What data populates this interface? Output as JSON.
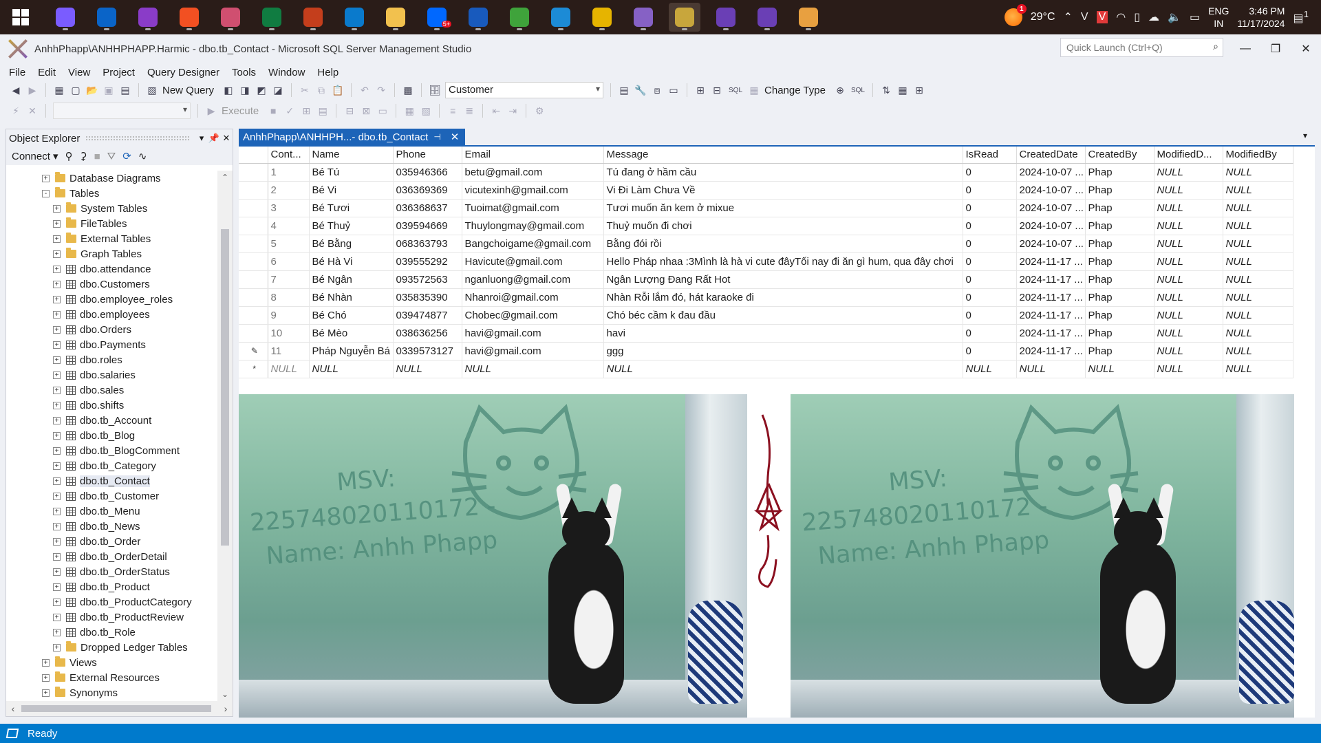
{
  "taskbar": {
    "apps": [
      {
        "name": "copilot-icon",
        "color": "#7a5cff",
        "active": false
      },
      {
        "name": "outlook-icon",
        "color": "#0a64c8",
        "active": false
      },
      {
        "name": "dev-app-icon",
        "color": "#8a3cc8",
        "active": false
      },
      {
        "name": "microsoft-store-icon",
        "color": "#f25022",
        "active": false
      },
      {
        "name": "slides-icon",
        "color": "#d04f70",
        "active": false
      },
      {
        "name": "excel-icon",
        "color": "#107c41",
        "active": false
      },
      {
        "name": "powerpoint-icon",
        "color": "#c43e1c",
        "active": false
      },
      {
        "name": "vscode-icon",
        "color": "#0a7acc",
        "active": false
      },
      {
        "name": "file-explorer-icon",
        "color": "#f2c14e",
        "active": false
      },
      {
        "name": "zalo-icon",
        "color": "#0068ff",
        "badge": "5+",
        "active": false
      },
      {
        "name": "word-icon",
        "color": "#185abd",
        "active": false
      },
      {
        "name": "cococ-browser-icon",
        "color": "#3fa33b",
        "active": false
      },
      {
        "name": "edge-icon",
        "color": "#1c8bd6",
        "active": false
      },
      {
        "name": "chrome-icon",
        "color": "#e6b400",
        "active": false
      },
      {
        "name": "visual-studio-icon",
        "color": "#8661c5",
        "active": false
      },
      {
        "name": "ssms-icon",
        "color": "#c8a63c",
        "active": true
      },
      {
        "name": "visual-studio-preview-icon",
        "color": "#6a3fb5",
        "active": false
      },
      {
        "name": "visual-studio-preview-2-icon",
        "color": "#6a3fb5",
        "active": false
      },
      {
        "name": "paint-icon",
        "color": "#e8a040",
        "active": false
      }
    ],
    "weather_badge": "1",
    "temperature": "29°C",
    "lang_top": "ENG",
    "lang_bottom": "IN",
    "time": "3:46 PM",
    "date": "11/17/2024",
    "notification_count": "1"
  },
  "window": {
    "title": "AnhhPhapp\\ANHHPHAPP.Harmic - dbo.tb_Contact - Microsoft SQL Server Management Studio",
    "quick_launch_placeholder": "Quick Launch (Ctrl+Q)"
  },
  "menu": [
    "File",
    "Edit",
    "View",
    "Project",
    "Query Designer",
    "Tools",
    "Window",
    "Help"
  ],
  "toolbar": {
    "new_query": "New Query",
    "database_combo": "Customer",
    "change_type": "Change Type",
    "execute": "Execute"
  },
  "object_explorer": {
    "title": "Object Explorer",
    "connect": "Connect",
    "nodes": [
      {
        "label": "Database Diagrams",
        "type": "folder",
        "level": 1,
        "exp": "+"
      },
      {
        "label": "Tables",
        "type": "folder",
        "level": 1,
        "exp": "-"
      },
      {
        "label": "System Tables",
        "type": "folder",
        "level": 2,
        "exp": "+"
      },
      {
        "label": "FileTables",
        "type": "folder",
        "level": 2,
        "exp": "+"
      },
      {
        "label": "External Tables",
        "type": "folder",
        "level": 2,
        "exp": "+"
      },
      {
        "label": "Graph Tables",
        "type": "folder",
        "level": 2,
        "exp": "+"
      },
      {
        "label": "dbo.attendance",
        "type": "table",
        "level": 2,
        "exp": "+"
      },
      {
        "label": "dbo.Customers",
        "type": "table",
        "level": 2,
        "exp": "+"
      },
      {
        "label": "dbo.employee_roles",
        "type": "table",
        "level": 2,
        "exp": "+"
      },
      {
        "label": "dbo.employees",
        "type": "table",
        "level": 2,
        "exp": "+"
      },
      {
        "label": "dbo.Orders",
        "type": "table",
        "level": 2,
        "exp": "+"
      },
      {
        "label": "dbo.Payments",
        "type": "table",
        "level": 2,
        "exp": "+"
      },
      {
        "label": "dbo.roles",
        "type": "table",
        "level": 2,
        "exp": "+"
      },
      {
        "label": "dbo.salaries",
        "type": "table",
        "level": 2,
        "exp": "+"
      },
      {
        "label": "dbo.sales",
        "type": "table",
        "level": 2,
        "exp": "+"
      },
      {
        "label": "dbo.shifts",
        "type": "table",
        "level": 2,
        "exp": "+"
      },
      {
        "label": "dbo.tb_Account",
        "type": "table",
        "level": 2,
        "exp": "+"
      },
      {
        "label": "dbo.tb_Blog",
        "type": "table",
        "level": 2,
        "exp": "+"
      },
      {
        "label": "dbo.tb_BlogComment",
        "type": "table",
        "level": 2,
        "exp": "+"
      },
      {
        "label": "dbo.tb_Category",
        "type": "table",
        "level": 2,
        "exp": "+"
      },
      {
        "label": "dbo.tb_Contact",
        "type": "table",
        "level": 2,
        "exp": "+",
        "selected": true
      },
      {
        "label": "dbo.tb_Customer",
        "type": "table",
        "level": 2,
        "exp": "+"
      },
      {
        "label": "dbo.tb_Menu",
        "type": "table",
        "level": 2,
        "exp": "+"
      },
      {
        "label": "dbo.tb_News",
        "type": "table",
        "level": 2,
        "exp": "+"
      },
      {
        "label": "dbo.tb_Order",
        "type": "table",
        "level": 2,
        "exp": "+"
      },
      {
        "label": "dbo.tb_OrderDetail",
        "type": "table",
        "level": 2,
        "exp": "+"
      },
      {
        "label": "dbo.tb_OrderStatus",
        "type": "table",
        "level": 2,
        "exp": "+"
      },
      {
        "label": "dbo.tb_Product",
        "type": "table",
        "level": 2,
        "exp": "+"
      },
      {
        "label": "dbo.tb_ProductCategory",
        "type": "table",
        "level": 2,
        "exp": "+"
      },
      {
        "label": "dbo.tb_ProductReview",
        "type": "table",
        "level": 2,
        "exp": "+"
      },
      {
        "label": "dbo.tb_Role",
        "type": "table",
        "level": 2,
        "exp": "+"
      },
      {
        "label": "Dropped Ledger Tables",
        "type": "folder",
        "level": 2,
        "exp": "+"
      },
      {
        "label": "Views",
        "type": "folder",
        "level": 1,
        "exp": "+"
      },
      {
        "label": "External Resources",
        "type": "folder",
        "level": 1,
        "exp": "+"
      },
      {
        "label": "Synonyms",
        "type": "folder",
        "level": 1,
        "exp": "+"
      }
    ]
  },
  "document_tab": {
    "label": "AnhhPhapp\\ANHHPH...- dbo.tb_Contact"
  },
  "grid": {
    "columns": [
      "Cont...",
      "Name",
      "Phone",
      "Email",
      "Message",
      "IsRead",
      "CreatedDate",
      "CreatedBy",
      "ModifiedD...",
      "ModifiedBy"
    ],
    "rows": [
      {
        "marker": "",
        "cells": [
          "1",
          "Bé Tú",
          "035946366",
          "betu@gmail.com",
          "Tú đang ở hầm cầu",
          "0",
          "2024-10-07 ...",
          "Phap",
          "NULL",
          "NULL"
        ]
      },
      {
        "marker": "",
        "cells": [
          "2",
          "Bé Vi",
          "036369369",
          "vicutexinh@gmail.com",
          "Vi Đi Làm Chưa Về",
          "0",
          "2024-10-07 ...",
          "Phap",
          "NULL",
          "NULL"
        ]
      },
      {
        "marker": "",
        "cells": [
          "3",
          "Bé Tươi",
          "036368637",
          "Tuoimat@gmail.com",
          "Tươi muốn ăn kem ở mixue",
          "0",
          "2024-10-07 ...",
          "Phap",
          "NULL",
          "NULL"
        ]
      },
      {
        "marker": "",
        "cells": [
          "4",
          "Bé Thuỷ",
          "039594669",
          "Thuylongmay@gmail.com",
          "Thuỷ muốn đi chơi",
          "0",
          "2024-10-07 ...",
          "Phap",
          "NULL",
          "NULL"
        ]
      },
      {
        "marker": "",
        "cells": [
          "5",
          "Bé Bằng",
          "068363793",
          "Bangchoigame@gmail.com",
          "Bằng đói rồi",
          "0",
          "2024-10-07 ...",
          "Phap",
          "NULL",
          "NULL"
        ]
      },
      {
        "marker": "",
        "cells": [
          "6",
          "Bé Hà Vi",
          "039555292",
          "Havicute@gmail.com",
          "Hello Pháp nhaa :3Mình là hà vi cute đâyTối nay đi ăn gì hum, qua đây chơi",
          "0",
          "2024-11-17 ...",
          "Phap",
          "NULL",
          "NULL"
        ]
      },
      {
        "marker": "",
        "cells": [
          "7",
          "Bé Ngân",
          "093572563",
          "nganluong@gmail.com",
          "Ngân Lượng Đang Rất Hot",
          "0",
          "2024-11-17 ...",
          "Phap",
          "NULL",
          "NULL"
        ]
      },
      {
        "marker": "",
        "cells": [
          "8",
          "Bé Nhàn",
          "035835390",
          "Nhanroi@gmail.com",
          "Nhàn Rỗi lắm đó, hát karaoke đi",
          "0",
          "2024-11-17 ...",
          "Phap",
          "NULL",
          "NULL"
        ]
      },
      {
        "marker": "",
        "cells": [
          "9",
          "Bé Chó",
          "039474877",
          "Chobec@gmail.com",
          "Chó béc cầm k đau đầu",
          "0",
          "2024-11-17 ...",
          "Phap",
          "NULL",
          "NULL"
        ]
      },
      {
        "marker": "",
        "cells": [
          "10",
          "Bé Mèo",
          "038636256",
          "havi@gmail.com",
          "havi",
          "0",
          "2024-11-17 ...",
          "Phap",
          "NULL",
          "NULL"
        ]
      },
      {
        "marker": "✎",
        "cells": [
          "11",
          "Pháp Nguyễn Bá",
          "0339573127",
          "havi@gmail.com",
          "ggg",
          "0",
          "2024-11-17 ...",
          "Phap",
          "NULL",
          "NULL"
        ]
      },
      {
        "marker": "*",
        "cells": [
          "NULL",
          "NULL",
          "NULL",
          "NULL",
          "NULL",
          "NULL",
          "NULL",
          "NULL",
          "NULL",
          "NULL"
        ]
      }
    ]
  },
  "watermark": {
    "line1": "MSV:",
    "line2": "22574802011017​2 -",
    "line3": "Name: Anhh Phapp"
  },
  "status": {
    "text": "Ready"
  }
}
